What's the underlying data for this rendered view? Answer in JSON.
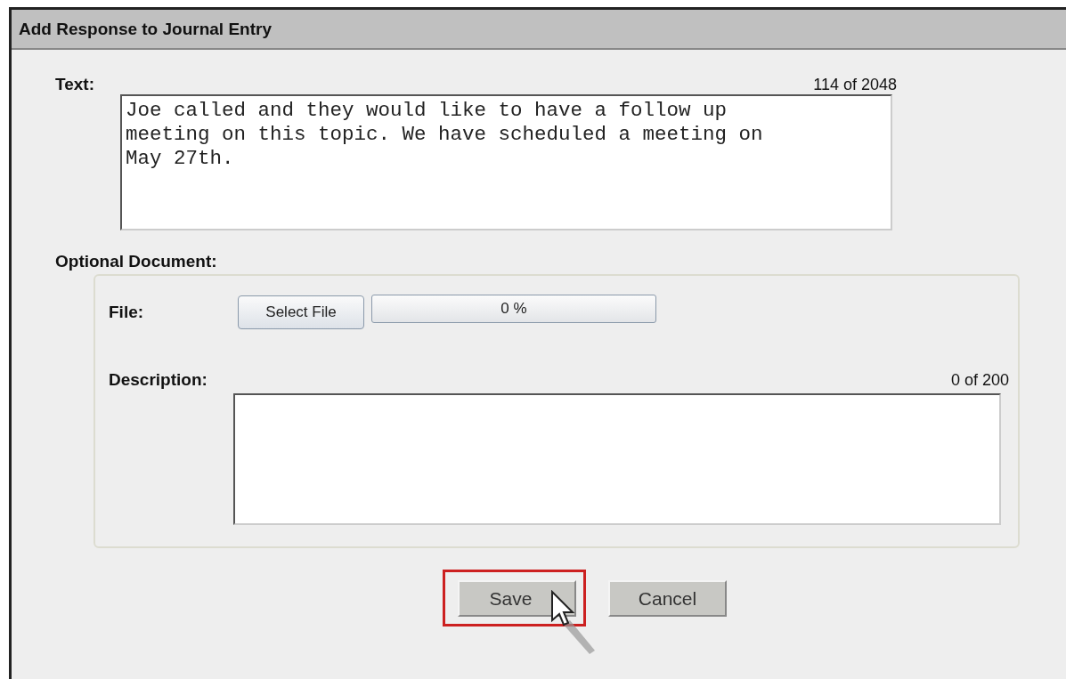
{
  "window": {
    "title": "Add Response to Journal Entry"
  },
  "text_field": {
    "label": "Text:",
    "counter": "114 of 2048",
    "value": "Joe called and they would like to have a follow up meeting on this topic. We have scheduled a meeting on May 27th."
  },
  "optional_document": {
    "label": "Optional Document:",
    "file_label": "File:",
    "select_button": "Select File",
    "progress": {
      "level": 0,
      "reading": "0 %"
    },
    "description": {
      "label": "Description:",
      "counter": "0 of 200"
    }
  },
  "buttons": [
    {
      "label": "Save",
      "highlighted": true,
      "pointer": true
    },
    {
      "label": "Cancel",
      "highlighted": false,
      "pointer": false
    }
  ]
}
